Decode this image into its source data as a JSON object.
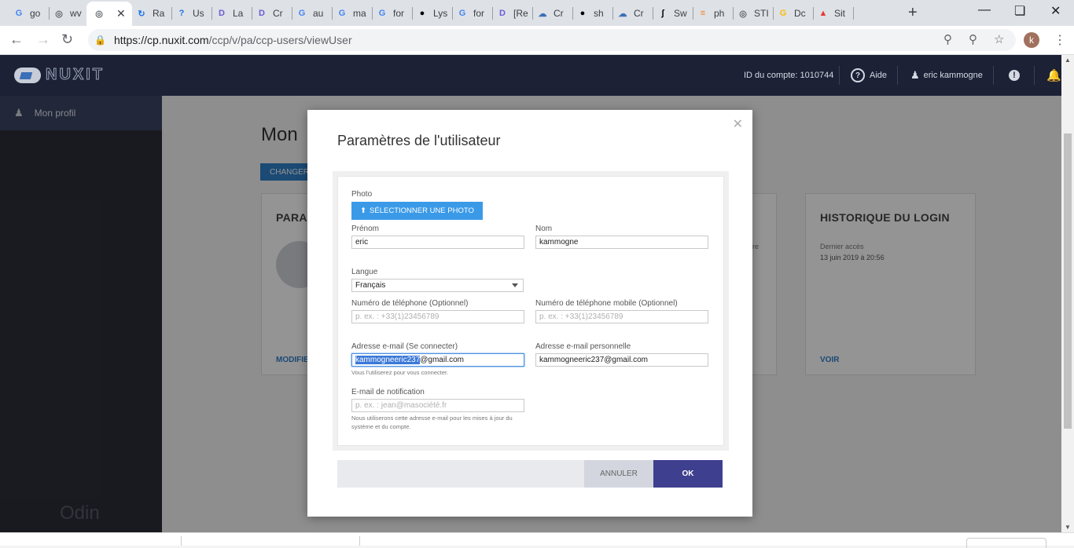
{
  "browser": {
    "tabs": [
      {
        "label": "go",
        "icon": "google-icon",
        "color": "#4285f4"
      },
      {
        "label": "wv",
        "icon": "globe-icon",
        "color": "#5f6368"
      },
      {
        "label": "",
        "icon": "globe-icon",
        "color": "#5f6368",
        "active": true
      },
      {
        "label": "Ra",
        "icon": "spinner-icon",
        "color": "#1a73e8"
      },
      {
        "label": "Us",
        "icon": "question-icon",
        "color": "#1a73e8"
      },
      {
        "label": "La",
        "icon": "d-icon",
        "color": "#6b5bd6"
      },
      {
        "label": "Cr",
        "icon": "d-icon",
        "color": "#6b5bd6"
      },
      {
        "label": "au",
        "icon": "google-icon",
        "color": "#4285f4"
      },
      {
        "label": "ma",
        "icon": "google-icon",
        "color": "#4285f4"
      },
      {
        "label": "for",
        "icon": "google-icon",
        "color": "#4285f4"
      },
      {
        "label": "Lys",
        "icon": "github-icon",
        "color": "#000000"
      },
      {
        "label": "for",
        "icon": "google-icon",
        "color": "#4285f4"
      },
      {
        "label": "[Re",
        "icon": "d-icon",
        "color": "#6b5bd6"
      },
      {
        "label": "Cr",
        "icon": "cloud-icon",
        "color": "#3b6fb6"
      },
      {
        "label": "sh",
        "icon": "github-icon",
        "color": "#000000"
      },
      {
        "label": "Cr",
        "icon": "cloud-icon",
        "color": "#3b6fb6"
      },
      {
        "label": "Sw",
        "icon": "symfony-icon",
        "color": "#000000"
      },
      {
        "label": "ph",
        "icon": "stack-icon",
        "color": "#f48024"
      },
      {
        "label": "STI",
        "icon": "globe-icon",
        "color": "#5f6368"
      },
      {
        "label": "Dc",
        "icon": "google-icon",
        "color": "#fbbc05"
      },
      {
        "label": "Sit",
        "icon": "hat-icon",
        "color": "#e53935"
      }
    ],
    "url_host": "https://cp.nuxit.com",
    "url_path": "/ccp/v/pa/ccp-users/viewUser",
    "profile_initial": "k"
  },
  "header": {
    "account_id": "ID du compte: 1010744",
    "help_label": "Aide",
    "user_label": "eric kammogne"
  },
  "sidebar": {
    "item_label": "Mon profil",
    "footer_brand": "Odin"
  },
  "page": {
    "title": "Mon",
    "change_button": "CHANGER",
    "card_param_title": "PARA",
    "card_param_link": "MODIFIE",
    "card_mid_text": "re",
    "card_login_title": "HISTORIQUE DU LOGIN",
    "card_login_label": "Dernier accès",
    "card_login_date": "13 juin 2019 à 20:56",
    "card_login_link": "VOIR"
  },
  "modal": {
    "title": "Paramètres de l'utilisateur",
    "photo_label": "Photo",
    "photo_button": "SÉLECTIONNER UNE PHOTO",
    "firstname_label": "Prénom",
    "firstname_value": "eric",
    "lastname_label": "Nom",
    "lastname_value": "kammogne",
    "language_label": "Langue",
    "language_value": "Français",
    "phone_label": "Numéro de téléphone (Optionnel)",
    "phone_placeholder": "p. ex. : +33(1)23456789",
    "mobile_label": "Numéro de téléphone mobile (Optionnel)",
    "mobile_placeholder": "p. ex. : +33(1)23456789",
    "login_email_label": "Adresse e-mail (Se connecter)",
    "login_email_selected": "kammogneeric237",
    "login_email_rest": "@gmail.com",
    "login_email_hint": "Vous l'utiliserez pour vous connecter.",
    "personal_email_label": "Adresse e-mail personnelle",
    "personal_email_value": "kammogneeric237@gmail.com",
    "notif_email_label": "E-mail de notification",
    "notif_email_placeholder": "p. ex. : jean@masociété.fr",
    "notif_email_hint": "Nous utiliserons cette adresse e-mail pour les mises à jour du système et du compte.",
    "cancel_button": "ANNULER",
    "ok_button": "OK"
  }
}
